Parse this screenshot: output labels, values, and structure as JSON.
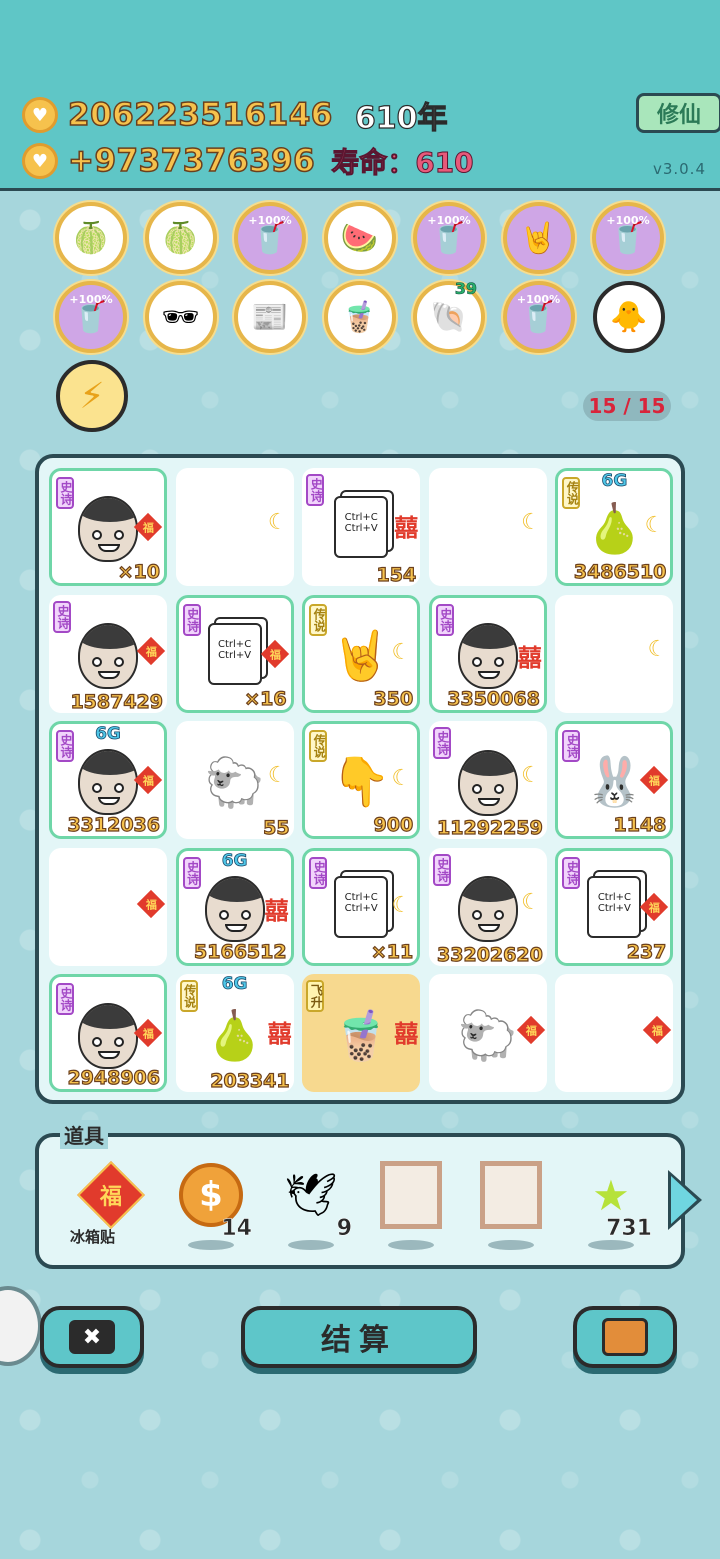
{
  "header": {
    "coins_total": "206223516146",
    "years": "610年",
    "coins_rate": "+9737376396",
    "lifespan": "寿命：610",
    "cultivate_label": "修仙",
    "version": "v3.0.4"
  },
  "relics_row1": [
    {
      "icon": "pomelo-icon",
      "glyph": "🍈",
      "purple": false,
      "label": ""
    },
    {
      "icon": "pomelo-icon",
      "glyph": "🍈",
      "purple": false,
      "label": ""
    },
    {
      "icon": "cup-bonus-icon",
      "glyph": "🥤",
      "purple": true,
      "label": "+100%"
    },
    {
      "icon": "fruit-basket-icon",
      "glyph": "🍉",
      "purple": false,
      "label": ""
    },
    {
      "icon": "cup-bonus-icon",
      "glyph": "🥤",
      "purple": true,
      "label": "+100%"
    },
    {
      "icon": "rock-hand-icon",
      "glyph": "🤘",
      "purple": true,
      "label": ""
    },
    {
      "icon": "cup-bonus-icon",
      "glyph": "🥤",
      "purple": true,
      "label": "+100%"
    }
  ],
  "relics_row2": [
    {
      "icon": "cup-bonus-icon",
      "glyph": "🥤",
      "purple": true,
      "label": "+100%"
    },
    {
      "icon": "pear-sunglasses-icon",
      "glyph": "🕶",
      "purple": false,
      "label": ""
    },
    {
      "icon": "time-magazine-icon",
      "glyph": "📰",
      "purple": false,
      "label": ""
    },
    {
      "icon": "milk-tea-icon",
      "glyph": "🧋",
      "purple": false,
      "label": ""
    },
    {
      "icon": "shell-icon",
      "glyph": "🐚",
      "purple": false,
      "label": "",
      "count": "39"
    },
    {
      "icon": "cup-bonus-icon",
      "glyph": "🥤",
      "purple": true,
      "label": "+100%"
    }
  ],
  "counter": "15 / 15",
  "board": [
    [
      {
        "type": "face",
        "tag": "史诗",
        "num": "×10",
        "badge": "fu",
        "epic": true
      },
      {
        "type": "empty",
        "badge": "moon"
      },
      {
        "type": "ctrl",
        "tag": "史诗",
        "num": "154",
        "badge": "xi",
        "epic": false
      },
      {
        "type": "empty",
        "badge": "moon"
      },
      {
        "type": "pear",
        "tag": "传说",
        "num": "3486510",
        "badge": "moon",
        "epic": true,
        "sixg": "6G"
      }
    ],
    [
      {
        "type": "face",
        "tag": "史诗",
        "num": "1587429",
        "badge": "fu",
        "epic": false
      },
      {
        "type": "ctrl",
        "tag": "史诗",
        "num": "×16",
        "badge": "fu",
        "epic": true
      },
      {
        "type": "rock",
        "tag": "传说",
        "num": "350",
        "badge": "moon",
        "epic": true
      },
      {
        "type": "face",
        "tag": "史诗",
        "num": "3350068",
        "badge": "xi",
        "epic": true
      },
      {
        "type": "empty",
        "badge": "moon"
      }
    ],
    [
      {
        "type": "face",
        "tag": "史诗",
        "num": "3312036",
        "badge": "fu",
        "epic": true,
        "sixg": "6G"
      },
      {
        "type": "sheep",
        "num": "55",
        "badge": "moon",
        "epic": false
      },
      {
        "type": "point",
        "tag": "传说",
        "num": "900",
        "badge": "moon",
        "epic": true
      },
      {
        "type": "face",
        "tag": "史诗",
        "num": "11292259",
        "badge": "moon",
        "epic": false
      },
      {
        "type": "rabbit",
        "tag": "史诗",
        "num": "1148",
        "badge": "fu",
        "epic": true
      }
    ],
    [
      {
        "type": "empty",
        "badge": "fu"
      },
      {
        "type": "face",
        "tag": "史诗",
        "num": "5166512",
        "badge": "xi",
        "epic": true,
        "sixg": "6G"
      },
      {
        "type": "ctrl",
        "tag": "史诗",
        "num": "×11",
        "badge": "moon",
        "epic": true
      },
      {
        "type": "face",
        "tag": "史诗",
        "num": "33202620",
        "badge": "moon",
        "epic": false
      },
      {
        "type": "ctrl",
        "tag": "史诗",
        "num": "237",
        "badge": "fu",
        "epic": true
      }
    ],
    [
      {
        "type": "face",
        "tag": "史诗",
        "num": "2948906",
        "badge": "fu",
        "epic": true
      },
      {
        "type": "pears",
        "tag": "传说",
        "num": "203341",
        "badge": "xi",
        "epic": false,
        "sixg": "6G"
      },
      {
        "type": "tea",
        "tag": "飞升",
        "num": "",
        "badge": "xi",
        "epic": false,
        "ascend": true
      },
      {
        "type": "sheep",
        "num": "",
        "badge": "fu",
        "epic": false
      },
      {
        "type": "empty",
        "badge": "fu"
      }
    ]
  ],
  "tools": {
    "title": "道具",
    "fridge_label": "冰箱贴",
    "fu_char": "福",
    "coin_qty": "14",
    "bird_qty": "9",
    "star_qty": "731"
  },
  "buttons": {
    "settle": "结算",
    "close": "✖"
  },
  "strings": {
    "ctrl_text": "Ctrl+C Ctrl+V",
    "fu": "福",
    "xi": "囍",
    "moon": "☾"
  }
}
